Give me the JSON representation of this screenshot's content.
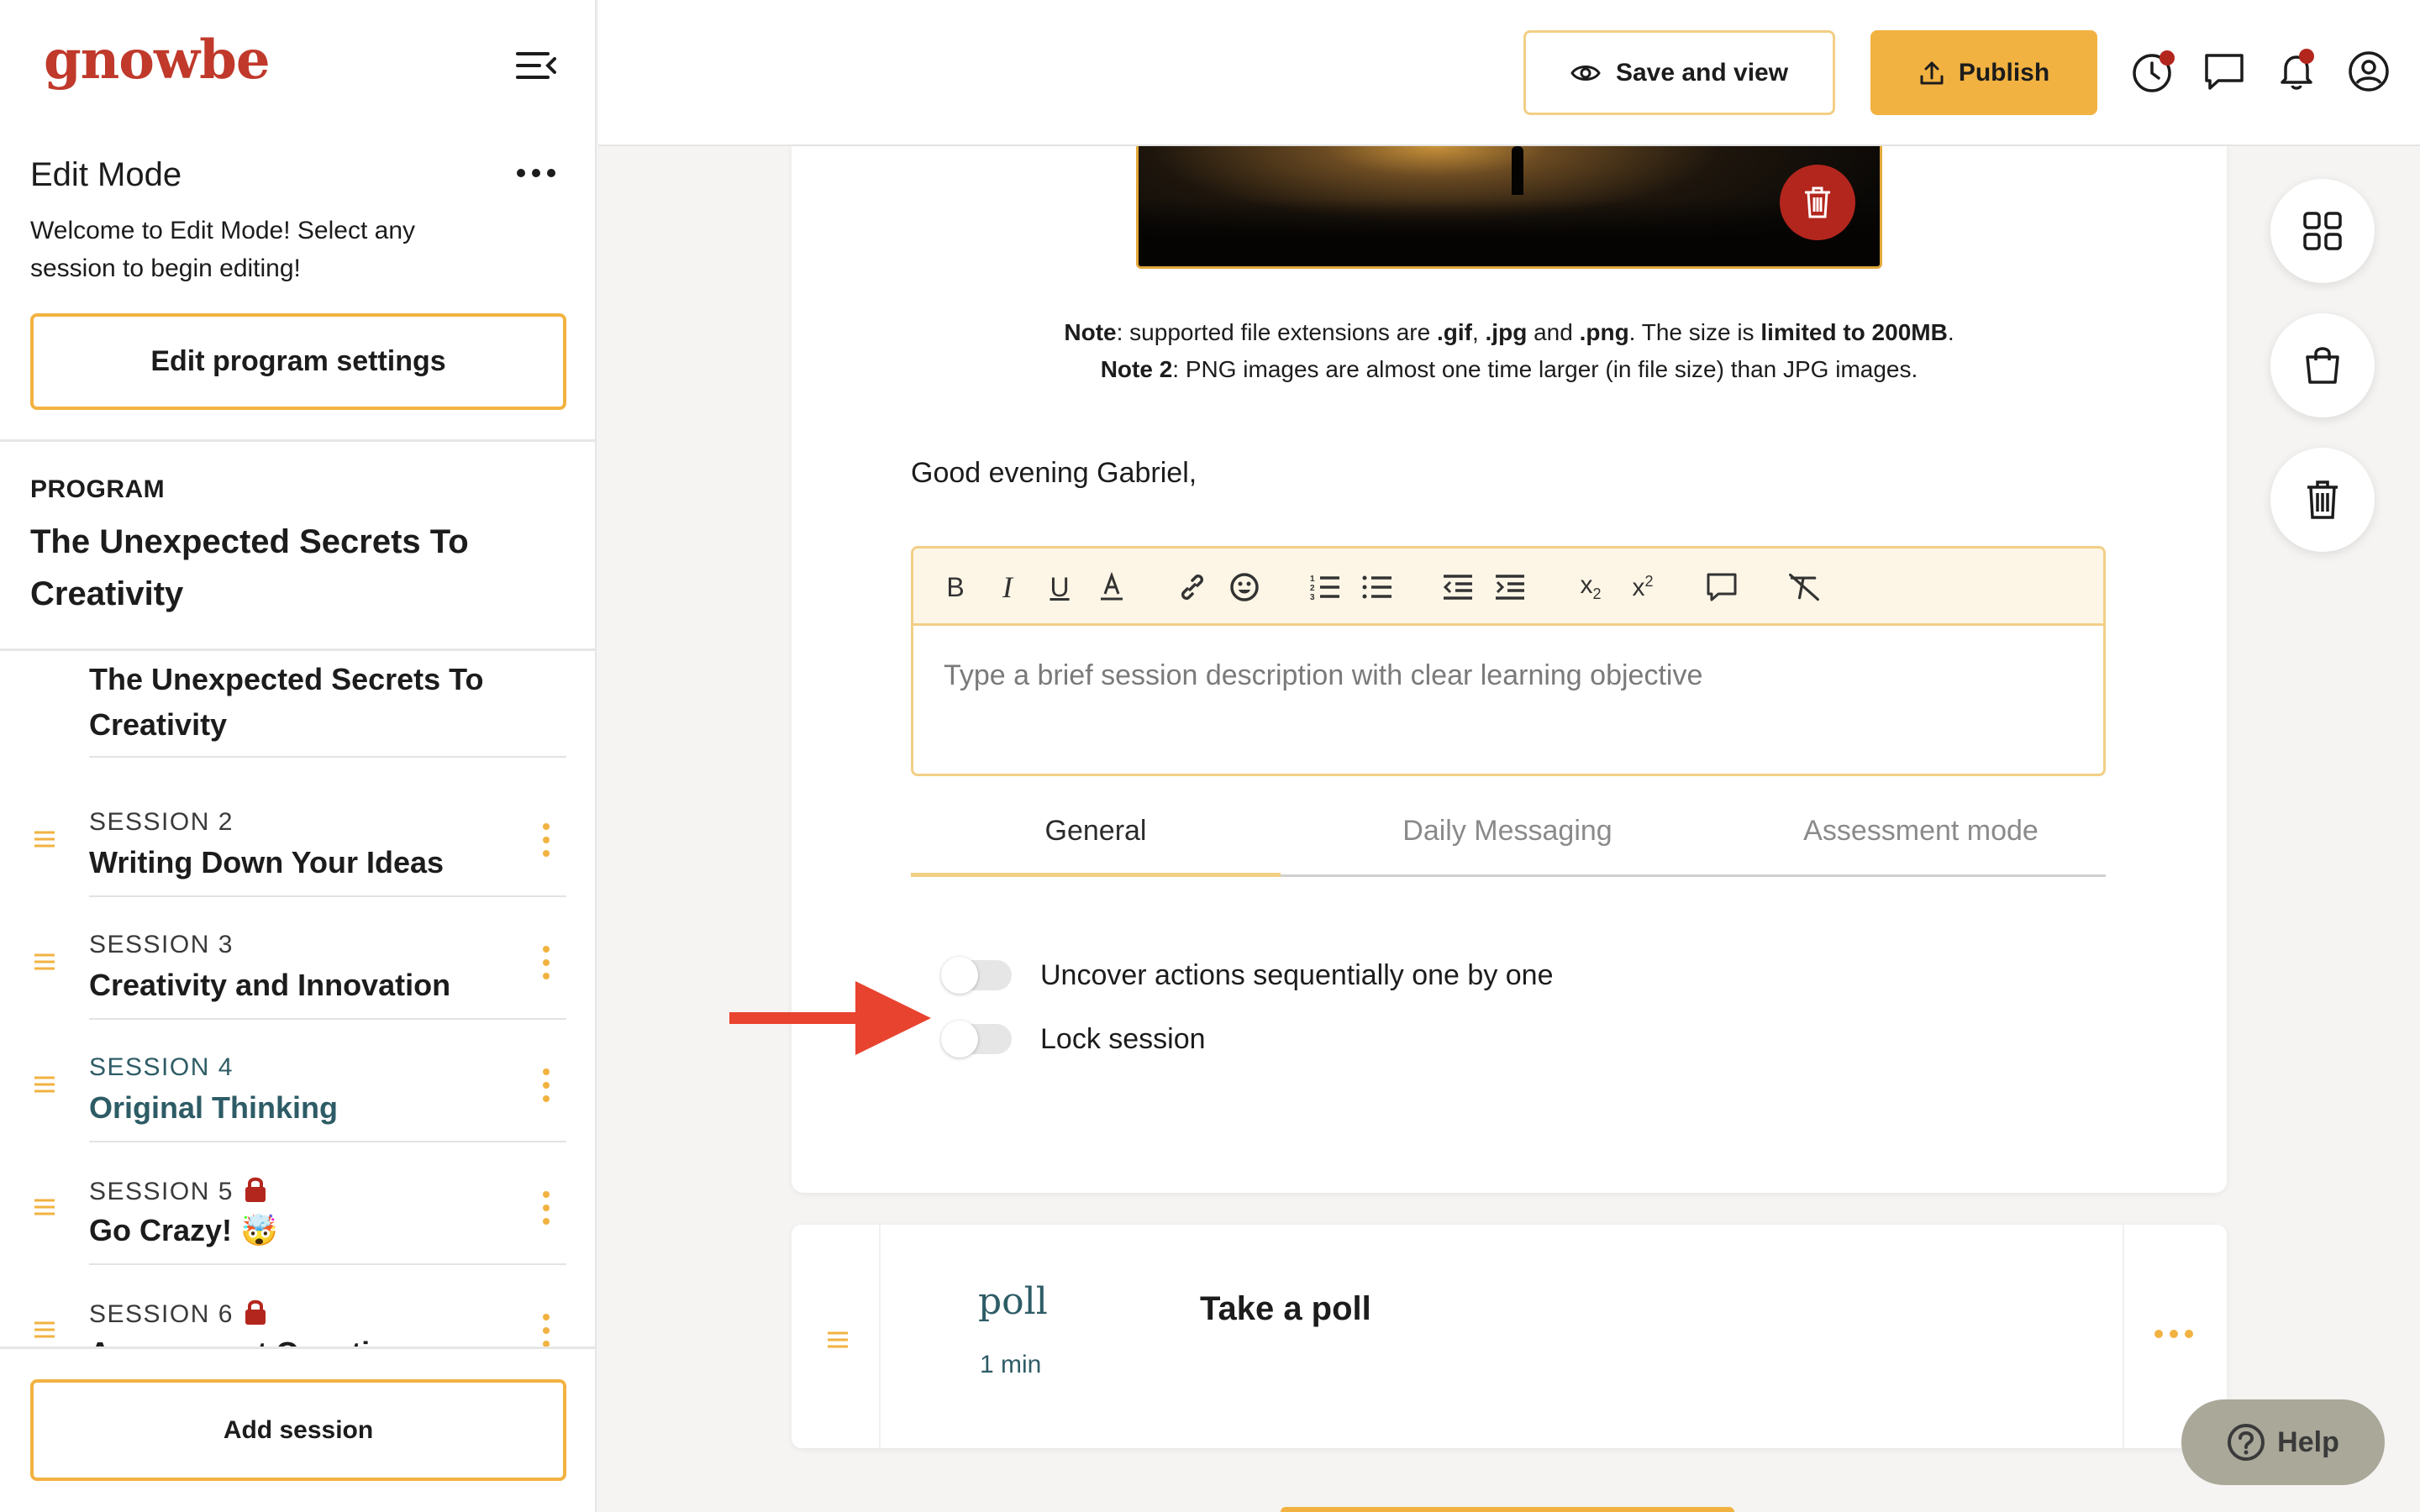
{
  "brand": {
    "logo_text": "gnowbe",
    "logo_color": "#c0392b"
  },
  "colors": {
    "accent": "#f2b241",
    "accent_light": "#f2cf86",
    "danger": "#b3261e",
    "teal": "#2e5c66",
    "arrow": "#e8432f"
  },
  "sidebar": {
    "edit_mode_title": "Edit Mode",
    "edit_mode_desc": "Welcome to Edit Mode! Select any session to begin editing!",
    "edit_settings_button": "Edit program settings",
    "program_label": "PROGRAM",
    "program_name": "The Unexpected Secrets To Creativity",
    "first_session_title": "The Unexpected Secrets To Creativity",
    "sessions": [
      {
        "label": "SESSION 2",
        "title": "Writing Down Your Ideas",
        "locked": false,
        "active": false
      },
      {
        "label": "SESSION 3",
        "title": "Creativity and Innovation",
        "locked": false,
        "active": false
      },
      {
        "label": "SESSION 4",
        "title": "Original Thinking",
        "locked": false,
        "active": true
      },
      {
        "label": "SESSION 5",
        "title": "Go Crazy! 🤯",
        "locked": true,
        "active": false
      },
      {
        "label": "SESSION 6",
        "title": "Assessment Questions",
        "locked": true,
        "active": false
      }
    ],
    "add_session_button": "Add session"
  },
  "topbar": {
    "save_view_label": "Save and view",
    "publish_label": "Publish",
    "icons": [
      "history-icon",
      "chat-icon",
      "bell-icon",
      "account-icon"
    ]
  },
  "editor": {
    "note1": {
      "prefix": "Note",
      "text1": ": supported file extensions are ",
      "gif": ".gif",
      "sep1": ", ",
      "jpg": ".jpg",
      "and": " and ",
      "png": ".png",
      "text2": ". The size is ",
      "limit": "limited to 200MB",
      "end": "."
    },
    "note2": {
      "prefix": "Note 2",
      "text": ": PNG images are almost one time larger (in file size) than JPG images."
    },
    "greeting": "Good evening Gabriel,",
    "description_placeholder": "Type a brief session description with clear learning objective",
    "toolbar_tools": [
      "bold",
      "italic",
      "underline",
      "font-color",
      "link",
      "emoji",
      "ordered-list",
      "bullet-list",
      "outdent",
      "indent",
      "subscript",
      "superscript",
      "comment",
      "clear-format"
    ],
    "tabs": [
      "General",
      "Daily Messaging",
      "Assessment mode"
    ],
    "active_tab": "General",
    "toggles": [
      {
        "label": "Uncover actions sequentially one by one",
        "on": false
      },
      {
        "label": "Lock session",
        "on": false
      }
    ]
  },
  "poll_card": {
    "type_word": "poll",
    "duration": "1 min",
    "title": "Take a poll"
  },
  "floating": {
    "buttons": [
      "grid-icon",
      "shopping-bag-icon",
      "trash-icon"
    ],
    "help_label": "Help"
  }
}
